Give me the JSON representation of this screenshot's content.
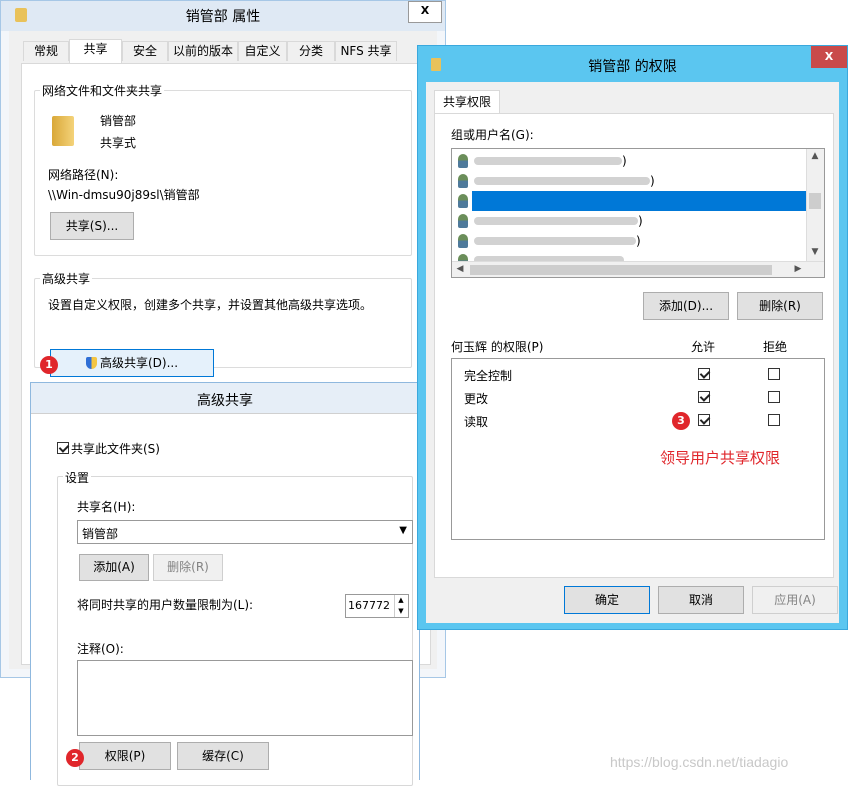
{
  "props_window": {
    "title": "销管部 属性",
    "close_label": "X",
    "tabs": [
      "常规",
      "共享",
      "安全",
      "以前的版本",
      "自定义",
      "分类",
      "NFS 共享"
    ],
    "network_group": {
      "label": "网络文件和文件夹共享",
      "folder_name": "销管部",
      "folder_status": "共享式",
      "path_label": "网络路径(N):",
      "path_value": "\\\\Win-dmsu90j89sl\\销管部",
      "share_button": "共享(S)..."
    },
    "advanced_group": {
      "label": "高级共享",
      "description": "设置自定义权限，创建多个共享，并设置其他高级共享选项。",
      "advanced_button": "高级共享(D)..."
    }
  },
  "adv_window": {
    "title": "高级共享",
    "share_checkbox_label": "共享此文件夹(S)",
    "share_checked": true,
    "settings_label": "设置",
    "share_name_label": "共享名(H):",
    "share_name_value": "销管部",
    "add_button": "添加(A)",
    "remove_button": "删除(R)",
    "limit_label": "将同时共享的用户数量限制为(L):",
    "limit_value": "167772",
    "comment_label": "注释(O):",
    "comment_value": "",
    "perm_button": "权限(P)",
    "cache_button": "缓存(C)"
  },
  "perm_window": {
    "title": "销管部 的权限",
    "close_label": "X",
    "tab": "共享权限",
    "users_label": "组或用户名(G):",
    "users": [
      {
        "name": ")"
      },
      {
        "name": ")"
      },
      {
        "name": ""
      },
      {
        "name": ")"
      },
      {
        "name": ")"
      },
      {
        "name": ""
      }
    ],
    "add_button": "添加(D)...",
    "remove_button": "删除(R)",
    "perm_header": "何玉辉 的权限(P)",
    "allow_header": "允许",
    "deny_header": "拒绝",
    "permissions": [
      {
        "name": "完全控制",
        "allow": true,
        "deny": false
      },
      {
        "name": "更改",
        "allow": true,
        "deny": false
      },
      {
        "name": "读取",
        "allow": true,
        "deny": false
      }
    ],
    "annotation": "领导用户共享权限",
    "ok_button": "确定",
    "cancel_button": "取消",
    "apply_button": "应用(A)"
  },
  "badges": [
    "1",
    "2",
    "3"
  ],
  "watermark": "https://blog.csdn.net/tiadagio",
  "colors": {
    "window_border": "#6db5ea",
    "title_bar": "#dce9f7",
    "perm_title_bar": "#56c4ef",
    "close_red": "#c94040",
    "selected_row": "#0078d7",
    "annotation_red": "#e0262b",
    "badge_red": "#e0262b"
  }
}
